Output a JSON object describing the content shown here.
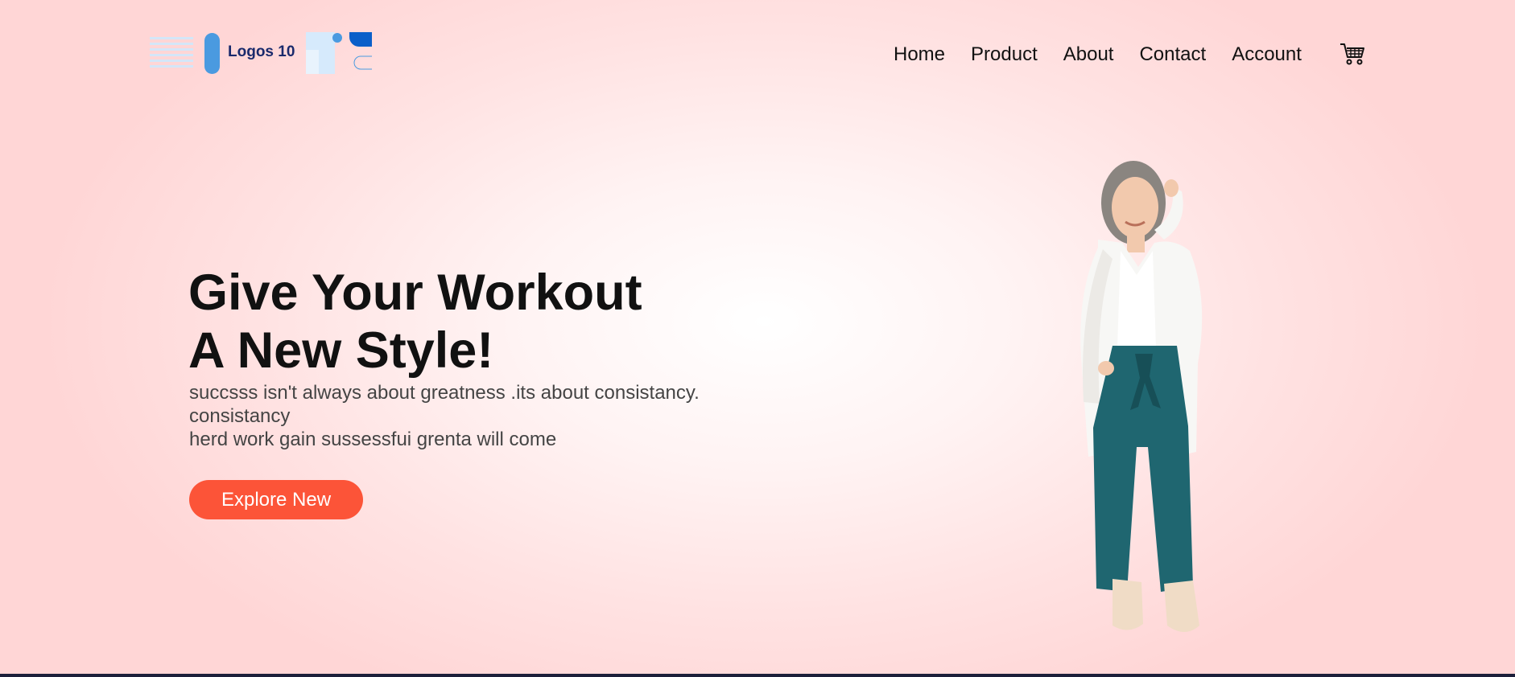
{
  "logo": {
    "text": "Logos 10",
    "icon": "logo-mark"
  },
  "nav": {
    "items": [
      "Home",
      "Product",
      "About",
      "Contact",
      "Account"
    ],
    "cart_icon": "cart-icon"
  },
  "hero": {
    "headline_line1": "Give Your Workout",
    "headline_line2": "A New Style!",
    "sub_line1": "succsss isn't always about greatness .its about consistancy.",
    "sub_line2": "consistancy",
    "sub_line3": "herd work gain sussessfui grenta will come",
    "cta_label": "Explore New",
    "image": "woman-in-white-blazer-and-teal-pants"
  },
  "colors": {
    "accent": "#fc5438",
    "logo_text": "#1a2a6c",
    "background": "#ffe2e2",
    "footer_bar": "#1c1f3a"
  }
}
